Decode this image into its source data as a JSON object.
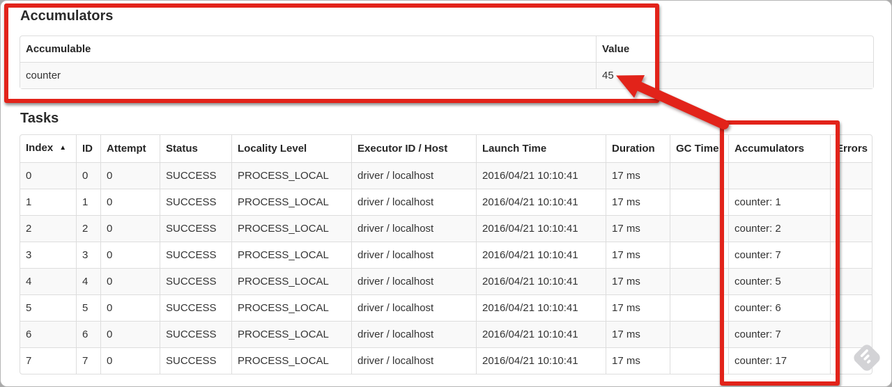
{
  "accumulators_section": {
    "title": "Accumulators",
    "table": {
      "headers": [
        "Accumulable",
        "Value"
      ],
      "rows": [
        [
          "counter",
          "45"
        ]
      ]
    }
  },
  "tasks_section": {
    "title": "Tasks",
    "table": {
      "headers": [
        "Index",
        "ID",
        "Attempt",
        "Status",
        "Locality Level",
        "Executor ID / Host",
        "Launch Time",
        "Duration",
        "GC Time",
        "Accumulators",
        "Errors"
      ],
      "sort": {
        "column_index": 0,
        "direction": "ascending",
        "icon": "▲"
      },
      "rows": [
        [
          "0",
          "0",
          "0",
          "SUCCESS",
          "PROCESS_LOCAL",
          "driver / localhost",
          "2016/04/21 10:10:41",
          "17 ms",
          "",
          "",
          ""
        ],
        [
          "1",
          "1",
          "0",
          "SUCCESS",
          "PROCESS_LOCAL",
          "driver / localhost",
          "2016/04/21 10:10:41",
          "17 ms",
          "",
          "counter: 1",
          ""
        ],
        [
          "2",
          "2",
          "0",
          "SUCCESS",
          "PROCESS_LOCAL",
          "driver / localhost",
          "2016/04/21 10:10:41",
          "17 ms",
          "",
          "counter: 2",
          ""
        ],
        [
          "3",
          "3",
          "0",
          "SUCCESS",
          "PROCESS_LOCAL",
          "driver / localhost",
          "2016/04/21 10:10:41",
          "17 ms",
          "",
          "counter: 7",
          ""
        ],
        [
          "4",
          "4",
          "0",
          "SUCCESS",
          "PROCESS_LOCAL",
          "driver / localhost",
          "2016/04/21 10:10:41",
          "17 ms",
          "",
          "counter: 5",
          ""
        ],
        [
          "5",
          "5",
          "0",
          "SUCCESS",
          "PROCESS_LOCAL",
          "driver / localhost",
          "2016/04/21 10:10:41",
          "17 ms",
          "",
          "counter: 6",
          ""
        ],
        [
          "6",
          "6",
          "0",
          "SUCCESS",
          "PROCESS_LOCAL",
          "driver / localhost",
          "2016/04/21 10:10:41",
          "17 ms",
          "",
          "counter: 7",
          ""
        ],
        [
          "7",
          "7",
          "0",
          "SUCCESS",
          "PROCESS_LOCAL",
          "driver / localhost",
          "2016/04/21 10:10:41",
          "17 ms",
          "",
          "counter: 17",
          ""
        ]
      ]
    }
  },
  "annotations": {
    "color": "#e2231a"
  },
  "watermark": {
    "icon_color": "#d3d3d6"
  }
}
